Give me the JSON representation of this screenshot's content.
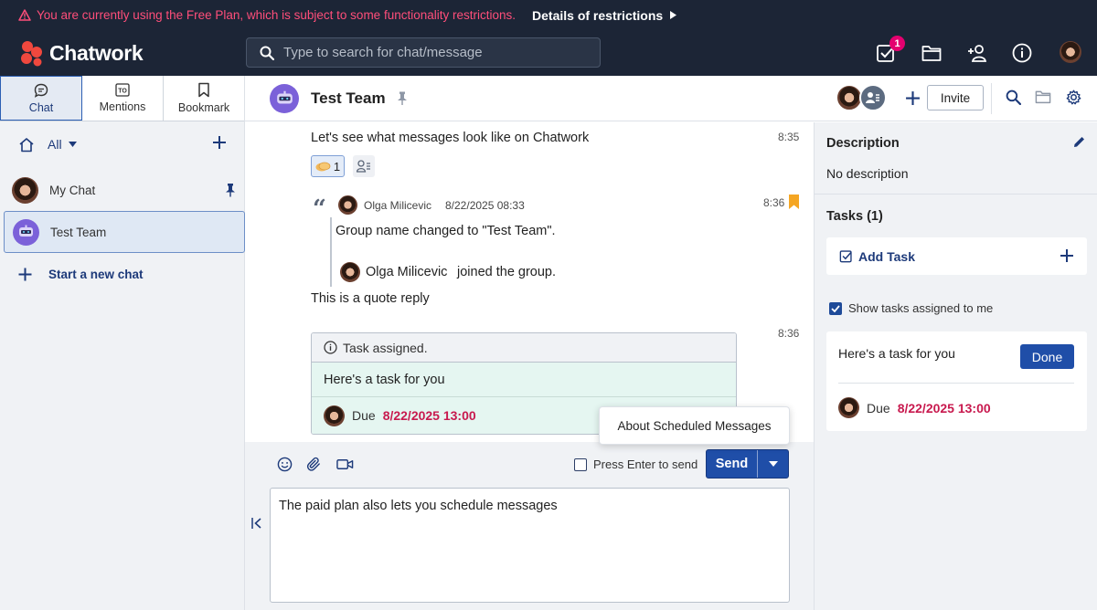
{
  "banner": {
    "warning": "You are currently using the Free Plan, which is subject to some functionality restrictions.",
    "details": "Details of restrictions"
  },
  "header": {
    "logo": "Chatwork",
    "search_placeholder": "Type to search for chat/message",
    "task_badge": "1"
  },
  "sidebar": {
    "tabs": [
      {
        "label": "Chat",
        "icon": "chat-bubble-icon",
        "active": true
      },
      {
        "label": "Mentions",
        "icon": "to-icon"
      },
      {
        "label": "Bookmark",
        "icon": "bookmark-icon"
      }
    ],
    "filter_label": "All",
    "rooms": [
      {
        "name": "My Chat",
        "pinned": true
      },
      {
        "name": "Test Team",
        "active": true
      }
    ],
    "start_new_chat": "Start a new chat"
  },
  "room": {
    "title": "Test Team",
    "invite_label": "Invite"
  },
  "timeline": {
    "msg1": {
      "text": "Let's see what messages look like on Chatwork",
      "time": "8:35",
      "reaction_count": "1"
    },
    "msg2": {
      "time": "8:36",
      "quote_author": "Olga Milicevic",
      "quote_timestamp": "8/22/2025 08:33",
      "quote_line1": "Group name changed to \"Test Team\".",
      "quote_joined_name": "Olga Milicevic",
      "quote_joined_text": "joined the group.",
      "reply": "This is a quote reply"
    },
    "msg3": {
      "time": "8:36",
      "task_header": "Task assigned.",
      "task_body": "Here's a task for you",
      "due_label": "Due",
      "due_date": "8/22/2025 13:00"
    }
  },
  "popup": {
    "label": "About Scheduled Messages"
  },
  "composer": {
    "press_enter_label": "Press Enter to send",
    "send_label": "Send",
    "draft": "The paid plan also lets you schedule messages"
  },
  "right_panel": {
    "description_title": "Description",
    "description_text": "No description",
    "tasks_title": "Tasks (1)",
    "add_task_label": "Add Task",
    "show_tasks_label": "Show tasks assigned to me",
    "task": {
      "text": "Here's a task for you",
      "done_label": "Done",
      "due_label": "Due",
      "due_date": "8/22/2025 13:00"
    }
  },
  "colors": {
    "header_bg": "#1c2536",
    "warning": "#ff4e7a",
    "accent": "#1f4ea8",
    "due": "#c8194e",
    "task_bg": "#e5f6f1"
  }
}
